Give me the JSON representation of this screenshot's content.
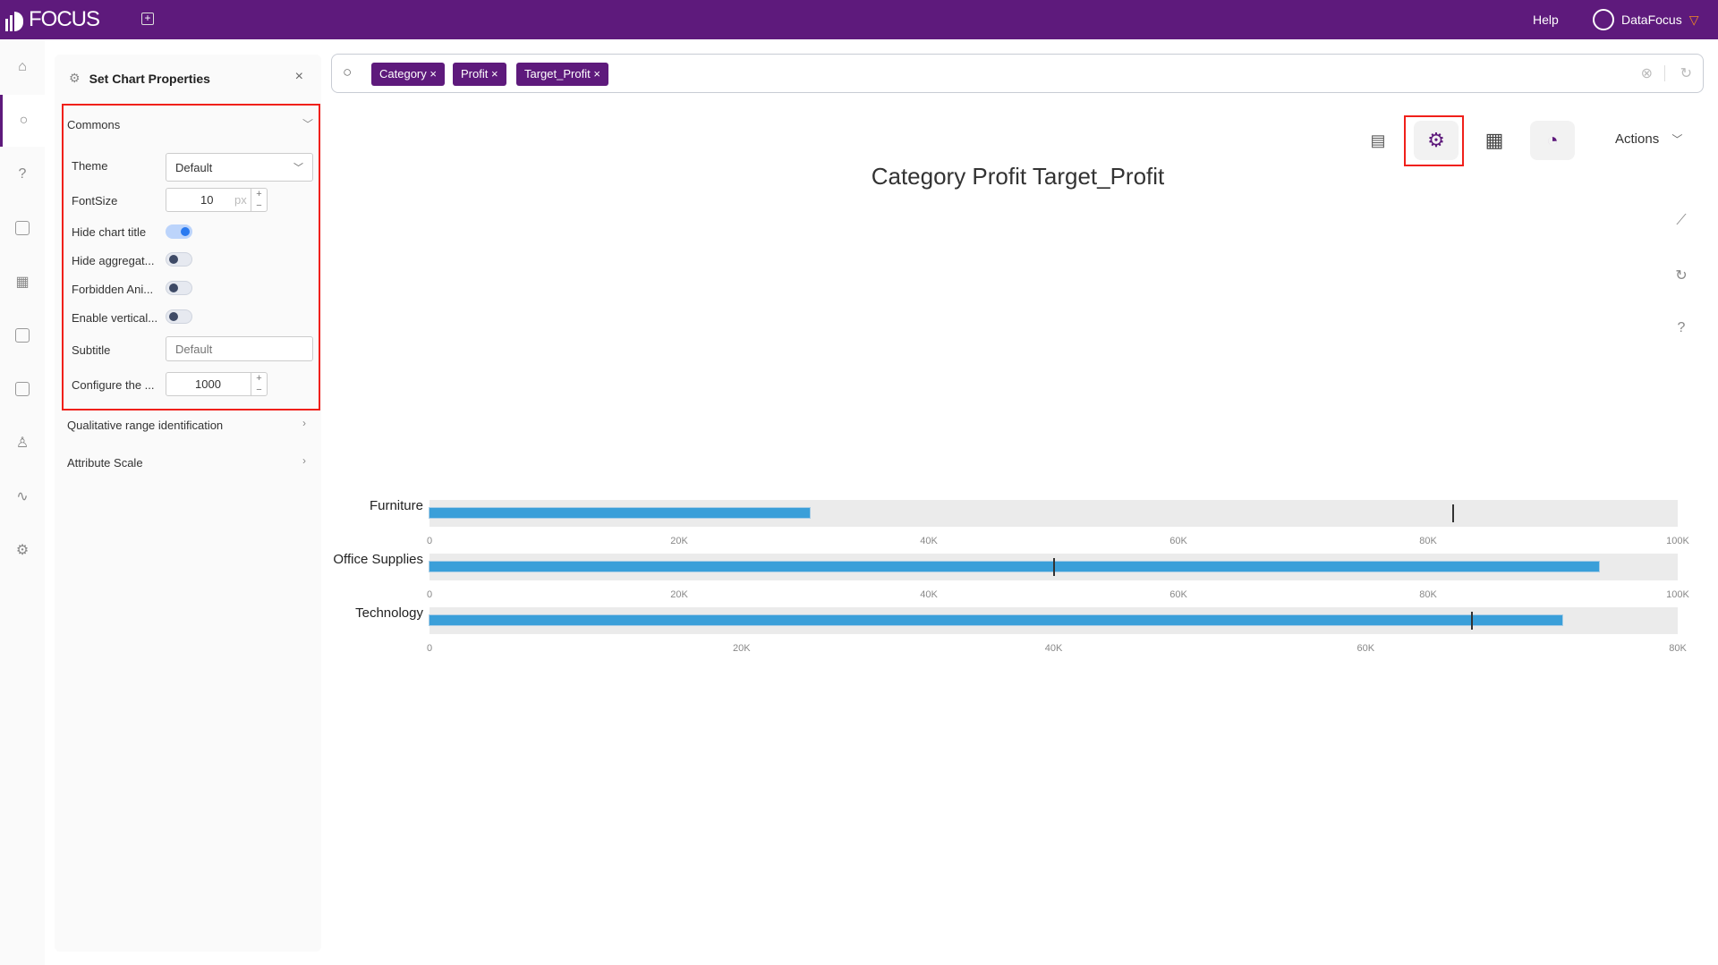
{
  "app": {
    "logo": "FOCUS",
    "help": "Help",
    "user": "DataFocus"
  },
  "panel": {
    "title": "Set Chart Properties",
    "commons": "Commons",
    "theme_label": "Theme",
    "theme_value": "Default",
    "fontsize_label": "FontSize",
    "fontsize_value": "10",
    "fontsize_unit": "px",
    "toggles": [
      {
        "label": "Hide chart title",
        "on": true
      },
      {
        "label": "Hide aggregat...",
        "on": false
      },
      {
        "label": "Forbidden Ani...",
        "on": false
      },
      {
        "label": "Enable vertical...",
        "on": false
      }
    ],
    "subtitle_label": "Subtitle",
    "subtitle_placeholder": "Default",
    "configure_label": "Configure the ...",
    "configure_value": "1000",
    "qualitative": "Qualitative range identification",
    "attribute_scale": "Attribute Scale"
  },
  "search": {
    "chips": [
      "Category",
      "Profit",
      "Target_Profit"
    ]
  },
  "toolbar": {
    "actions": "Actions"
  },
  "colors": {
    "brand": "#5e1a7c",
    "bar": "#3a9fd9",
    "band": "#ebebeb",
    "highlight": "#f0201a"
  },
  "chart_data": {
    "type": "bullet",
    "title": "Category Profit Target_Profit",
    "rows": [
      {
        "category": "Furniture",
        "value": 30500,
        "target": 82000,
        "max": 100000,
        "ticks": [
          "0",
          "20K",
          "40K",
          "60K",
          "80K",
          "100K"
        ]
      },
      {
        "category": "Office Supplies",
        "value": 93700,
        "target": 50000,
        "max": 100000,
        "ticks": [
          "0",
          "20K",
          "40K",
          "60K",
          "80K",
          "100K"
        ]
      },
      {
        "category": "Technology",
        "value": 72600,
        "target": 66800,
        "max": 80000,
        "ticks": [
          "0",
          "20K",
          "40K",
          "60K",
          "80K"
        ]
      }
    ]
  }
}
